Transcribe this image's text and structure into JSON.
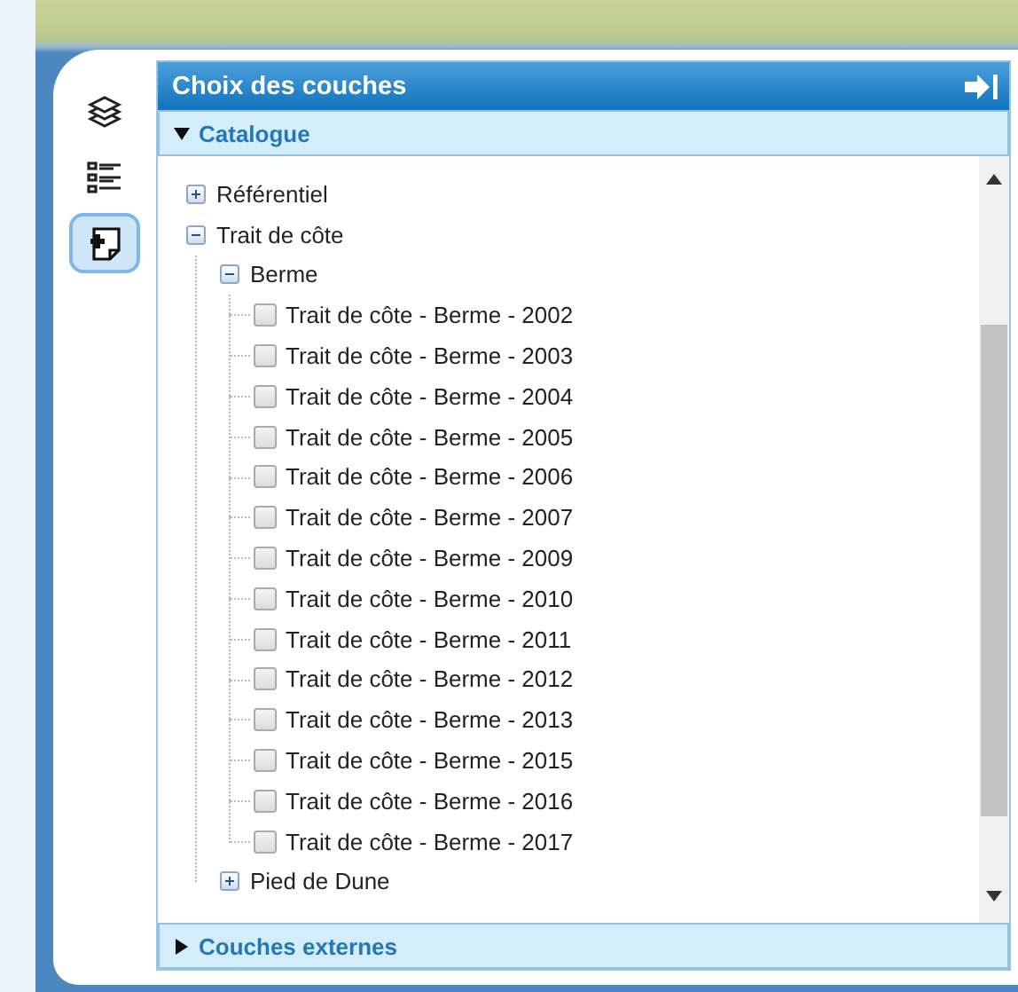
{
  "side_tabs": [
    {
      "kind": "layers",
      "selected": false
    },
    {
      "kind": "legend",
      "selected": false
    },
    {
      "kind": "add",
      "selected": true
    }
  ],
  "panel": {
    "title": "Choix des couches"
  },
  "sections": [
    {
      "label": "Catalogue",
      "expanded": true,
      "tree": [
        {
          "kind": "group",
          "label": "Référentiel",
          "expanded": false
        },
        {
          "kind": "group",
          "label": "Trait de côte",
          "expanded": true,
          "children": [
            {
              "kind": "group",
              "label": "Berme",
              "expanded": true,
              "children": [
                {
                  "kind": "layer",
                  "label": "Trait de côte - Berme - 2002",
                  "checked": false
                },
                {
                  "kind": "layer",
                  "label": "Trait de côte - Berme - 2003",
                  "checked": false
                },
                {
                  "kind": "layer",
                  "label": "Trait de côte - Berme - 2004",
                  "checked": false
                },
                {
                  "kind": "layer",
                  "label": "Trait de côte - Berme - 2005",
                  "checked": false
                },
                {
                  "kind": "layer",
                  "label": "Trait de côte - Berme - 2006",
                  "checked": false
                },
                {
                  "kind": "layer",
                  "label": "Trait de côte - Berme - 2007",
                  "checked": false
                },
                {
                  "kind": "layer",
                  "label": "Trait de côte - Berme - 2009",
                  "checked": false
                },
                {
                  "kind": "layer",
                  "label": "Trait de côte - Berme - 2010",
                  "checked": false
                },
                {
                  "kind": "layer",
                  "label": "Trait de côte - Berme - 2011",
                  "checked": false
                },
                {
                  "kind": "layer",
                  "label": "Trait de côte - Berme - 2012",
                  "checked": false
                },
                {
                  "kind": "layer",
                  "label": "Trait de côte - Berme - 2013",
                  "checked": false
                },
                {
                  "kind": "layer",
                  "label": "Trait de côte - Berme - 2015",
                  "checked": false
                },
                {
                  "kind": "layer",
                  "label": "Trait de côte - Berme - 2016",
                  "checked": false
                },
                {
                  "kind": "layer",
                  "label": "Trait de côte - Berme - 2017",
                  "checked": false
                }
              ]
            },
            {
              "kind": "group",
              "label": "Pied de Dune",
              "expanded": false
            }
          ]
        }
      ]
    },
    {
      "label": "Couches externes",
      "expanded": false
    }
  ]
}
